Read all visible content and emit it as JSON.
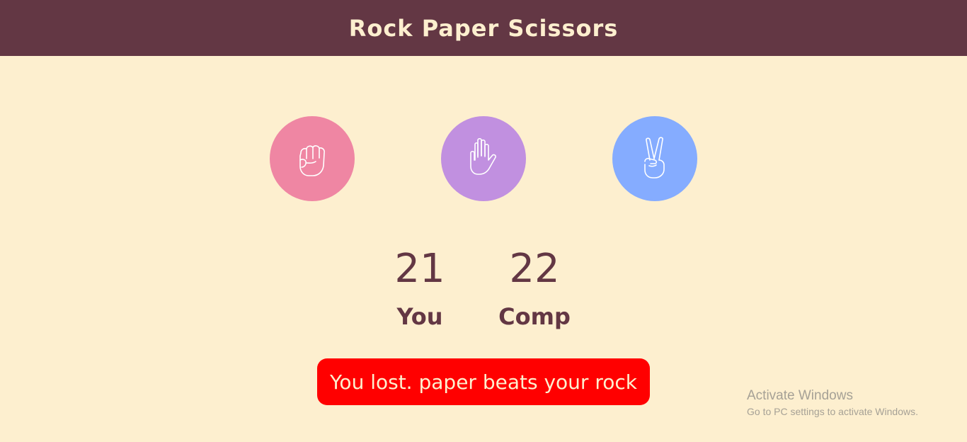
{
  "header": {
    "title": "Rock Paper Scissors"
  },
  "choices": [
    {
      "id": "rock",
      "icon": "fist-icon",
      "color": "#ef86a3"
    },
    {
      "id": "paper",
      "icon": "open-hand-icon",
      "color": "#c190e0"
    },
    {
      "id": "scissors",
      "icon": "peace-hand-icon",
      "color": "#85acff"
    }
  ],
  "scoreboard": {
    "you": {
      "score": "21",
      "label": "You"
    },
    "comp": {
      "score": "22",
      "label": "Comp"
    }
  },
  "result": {
    "message": "You lost. paper beats your rock",
    "color": "#ff0000"
  },
  "watermark": {
    "title": "Activate Windows",
    "subtitle": "Go to PC settings to activate Windows."
  },
  "theme": {
    "header_bg": "#633744",
    "page_bg": "#fdefcf"
  }
}
